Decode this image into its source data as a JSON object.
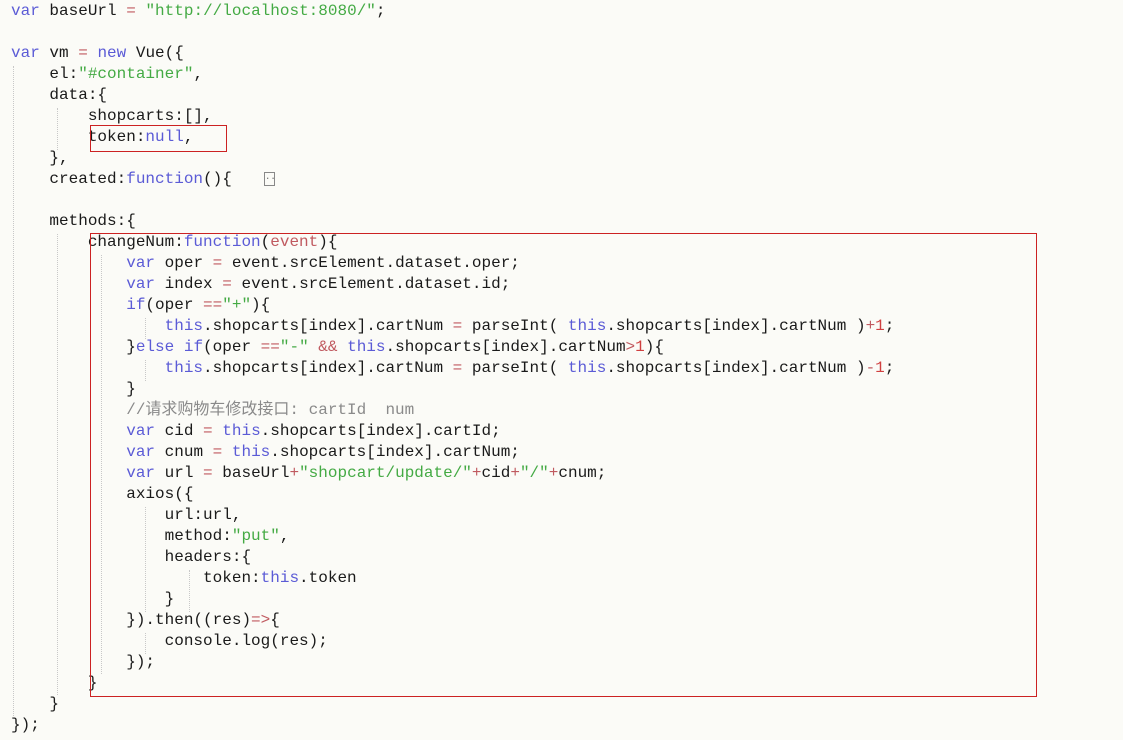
{
  "colors": {
    "background": "#fbfbf7",
    "keyword": "#5b5bd6",
    "string": "#44aa44",
    "number": "#d04040",
    "operator": "#c05a60",
    "comment": "#8a8a8a",
    "highlight_border": "#cc2222"
  },
  "fold_marker_text": "...",
  "lines": [
    [
      [
        "kw",
        "var"
      ],
      [
        "plain",
        " baseUrl "
      ],
      [
        "op",
        "="
      ],
      [
        "plain",
        " "
      ],
      [
        "str",
        "\"http://localhost:8080/\""
      ],
      [
        "plain",
        ";"
      ]
    ],
    [],
    [
      [
        "kw",
        "var"
      ],
      [
        "plain",
        " vm "
      ],
      [
        "op",
        "="
      ],
      [
        "plain",
        " "
      ],
      [
        "kw",
        "new"
      ],
      [
        "plain",
        " Vue({"
      ]
    ],
    [
      [
        "plain",
        "    el:"
      ],
      [
        "str",
        "\"#container\""
      ],
      [
        "plain",
        ","
      ]
    ],
    [
      [
        "plain",
        "    data:{"
      ]
    ],
    [
      [
        "plain",
        "        shopcarts:[],"
      ]
    ],
    [
      [
        "plain",
        "        token:"
      ],
      [
        "kw",
        "null"
      ],
      [
        "plain",
        ","
      ]
    ],
    [
      [
        "plain",
        "    },"
      ]
    ],
    [
      [
        "plain",
        "    created:"
      ],
      [
        "kw",
        "function"
      ],
      [
        "plain",
        "(){"
      ]
    ],
    [],
    [
      [
        "plain",
        "    methods:{"
      ]
    ],
    [
      [
        "plain",
        "        changeNum:"
      ],
      [
        "kw",
        "function"
      ],
      [
        "plain",
        "("
      ],
      [
        "op",
        "event"
      ],
      [
        "plain",
        "){"
      ]
    ],
    [
      [
        "plain",
        "            "
      ],
      [
        "kw",
        "var"
      ],
      [
        "plain",
        " oper "
      ],
      [
        "op",
        "="
      ],
      [
        "plain",
        " event.srcElement.dataset.oper;"
      ]
    ],
    [
      [
        "plain",
        "            "
      ],
      [
        "kw",
        "var"
      ],
      [
        "plain",
        " index "
      ],
      [
        "op",
        "="
      ],
      [
        "plain",
        " event.srcElement.dataset.id;"
      ]
    ],
    [
      [
        "plain",
        "            "
      ],
      [
        "kw",
        "if"
      ],
      [
        "plain",
        "(oper "
      ],
      [
        "op",
        "=="
      ],
      [
        "str",
        "\"+\""
      ],
      [
        "plain",
        "){"
      ]
    ],
    [
      [
        "plain",
        "                "
      ],
      [
        "kw",
        "this"
      ],
      [
        "plain",
        ".shopcarts[index].cartNum "
      ],
      [
        "op",
        "="
      ],
      [
        "plain",
        " parseInt( "
      ],
      [
        "kw",
        "this"
      ],
      [
        "plain",
        ".shopcarts[index].cartNum )"
      ],
      [
        "op",
        "+"
      ],
      [
        "num",
        "1"
      ],
      [
        "plain",
        ";"
      ]
    ],
    [
      [
        "plain",
        "            }"
      ],
      [
        "kw",
        "else if"
      ],
      [
        "plain",
        "(oper "
      ],
      [
        "op",
        "=="
      ],
      [
        "str",
        "\"-\""
      ],
      [
        "plain",
        " "
      ],
      [
        "op",
        "&&"
      ],
      [
        "plain",
        " "
      ],
      [
        "kw",
        "this"
      ],
      [
        "plain",
        ".shopcarts[index].cartNum"
      ],
      [
        "op",
        ">"
      ],
      [
        "num",
        "1"
      ],
      [
        "plain",
        "){"
      ]
    ],
    [
      [
        "plain",
        "                "
      ],
      [
        "kw",
        "this"
      ],
      [
        "plain",
        ".shopcarts[index].cartNum "
      ],
      [
        "op",
        "="
      ],
      [
        "plain",
        " parseInt( "
      ],
      [
        "kw",
        "this"
      ],
      [
        "plain",
        ".shopcarts[index].cartNum )"
      ],
      [
        "op",
        "-"
      ],
      [
        "num",
        "1"
      ],
      [
        "plain",
        ";"
      ]
    ],
    [
      [
        "plain",
        "            }"
      ]
    ],
    [
      [
        "plain",
        "            "
      ],
      [
        "cmt",
        "//请求购物车修改接口: cartId  num"
      ]
    ],
    [
      [
        "plain",
        "            "
      ],
      [
        "kw",
        "var"
      ],
      [
        "plain",
        " cid "
      ],
      [
        "op",
        "="
      ],
      [
        "plain",
        " "
      ],
      [
        "kw",
        "this"
      ],
      [
        "plain",
        ".shopcarts[index].cartId;"
      ]
    ],
    [
      [
        "plain",
        "            "
      ],
      [
        "kw",
        "var"
      ],
      [
        "plain",
        " cnum "
      ],
      [
        "op",
        "="
      ],
      [
        "plain",
        " "
      ],
      [
        "kw",
        "this"
      ],
      [
        "plain",
        ".shopcarts[index].cartNum;"
      ]
    ],
    [
      [
        "plain",
        "            "
      ],
      [
        "kw",
        "var"
      ],
      [
        "plain",
        " url "
      ],
      [
        "op",
        "="
      ],
      [
        "plain",
        " baseUrl"
      ],
      [
        "op",
        "+"
      ],
      [
        "str",
        "\"shopcart/update/\""
      ],
      [
        "op",
        "+"
      ],
      [
        "plain",
        "cid"
      ],
      [
        "op",
        "+"
      ],
      [
        "str",
        "\"/\""
      ],
      [
        "op",
        "+"
      ],
      [
        "plain",
        "cnum;"
      ]
    ],
    [
      [
        "plain",
        "            axios({"
      ]
    ],
    [
      [
        "plain",
        "                url:url,"
      ]
    ],
    [
      [
        "plain",
        "                method:"
      ],
      [
        "str",
        "\"put\""
      ],
      [
        "plain",
        ","
      ]
    ],
    [
      [
        "plain",
        "                headers:{"
      ]
    ],
    [
      [
        "plain",
        "                    token:"
      ],
      [
        "kw",
        "this"
      ],
      [
        "plain",
        ".token"
      ]
    ],
    [
      [
        "plain",
        "                }"
      ]
    ],
    [
      [
        "plain",
        "            }).then((res)"
      ],
      [
        "op",
        "=>"
      ],
      [
        "plain",
        "{"
      ]
    ],
    [
      [
        "plain",
        "                console.log(res);"
      ]
    ],
    [
      [
        "plain",
        "            });"
      ]
    ],
    [
      [
        "plain",
        "        }"
      ]
    ],
    [
      [
        "plain",
        "    }"
      ]
    ],
    [
      [
        "plain",
        "});"
      ]
    ]
  ]
}
